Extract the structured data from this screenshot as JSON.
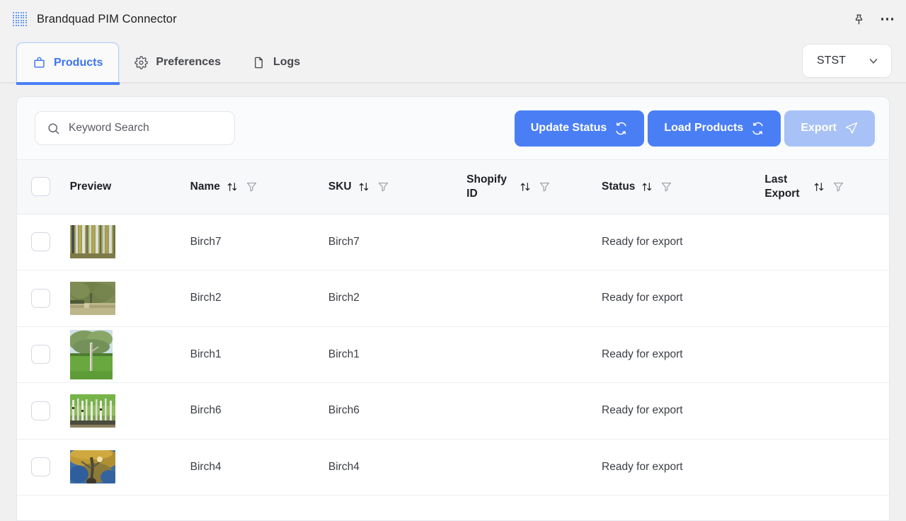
{
  "titlebar": {
    "app_name": "Brandquad PIM Connector",
    "logo_icon": "dot-grid-icon",
    "pin_icon": "pushpin-icon",
    "more_icon": "more-horizontal-icon"
  },
  "tabs": [
    {
      "label": "Products",
      "icon": "bag-icon",
      "active": true
    },
    {
      "label": "Preferences",
      "icon": "gear-icon",
      "active": false
    },
    {
      "label": "Logs",
      "icon": "file-icon",
      "active": false
    }
  ],
  "store_selector": {
    "value": "STST",
    "chevron_icon": "chevron-down-icon"
  },
  "toolbar": {
    "search_placeholder": "Keyword Search",
    "search_value": "",
    "search_icon": "search-icon",
    "buttons": [
      {
        "label": "Update Status",
        "icon": "refresh-icon",
        "style": "primary"
      },
      {
        "label": "Load Products",
        "icon": "refresh-icon",
        "style": "primary"
      },
      {
        "label": "Export",
        "icon": "send-icon",
        "style": "muted"
      }
    ]
  },
  "table": {
    "select_all_checkbox": false,
    "columns": [
      {
        "label": "Preview",
        "sortable": false,
        "filterable": false
      },
      {
        "label": "Name",
        "sortable": true,
        "filterable": true
      },
      {
        "label": "SKU",
        "sortable": true,
        "filterable": true
      },
      {
        "label": "Shopify ID",
        "sortable": true,
        "filterable": true
      },
      {
        "label": "Status",
        "sortable": true,
        "filterable": true
      },
      {
        "label": "Last Export",
        "sortable": true,
        "filterable": true
      }
    ],
    "rows": [
      {
        "selected": false,
        "preview": "birch-trunks-autumn",
        "name": "Birch7",
        "sku": "Birch7",
        "shopify_id": "",
        "status": "Ready for export",
        "last_export": ""
      },
      {
        "selected": false,
        "preview": "birch-single-field",
        "name": "Birch2",
        "sku": "Birch2",
        "shopify_id": "",
        "status": "Ready for export",
        "last_export": ""
      },
      {
        "selected": false,
        "preview": "birch-lawn-portrait",
        "name": "Birch1",
        "sku": "Birch1",
        "shopify_id": "",
        "status": "Ready for export",
        "last_export": ""
      },
      {
        "selected": false,
        "preview": "birch-grove-green",
        "name": "Birch6",
        "sku": "Birch6",
        "shopify_id": "",
        "status": "Ready for export",
        "last_export": ""
      },
      {
        "selected": false,
        "preview": "birch-canopy-gold",
        "name": "Birch4",
        "sku": "Birch4",
        "shopify_id": "",
        "status": "Ready for export",
        "last_export": ""
      }
    ]
  },
  "colors": {
    "accent": "#4a7ef5",
    "accent_muted": "#a8c1f7",
    "tab_active_text": "#3b74f2",
    "page_background": "#f0f0f0",
    "card_background": "#ffffff"
  }
}
